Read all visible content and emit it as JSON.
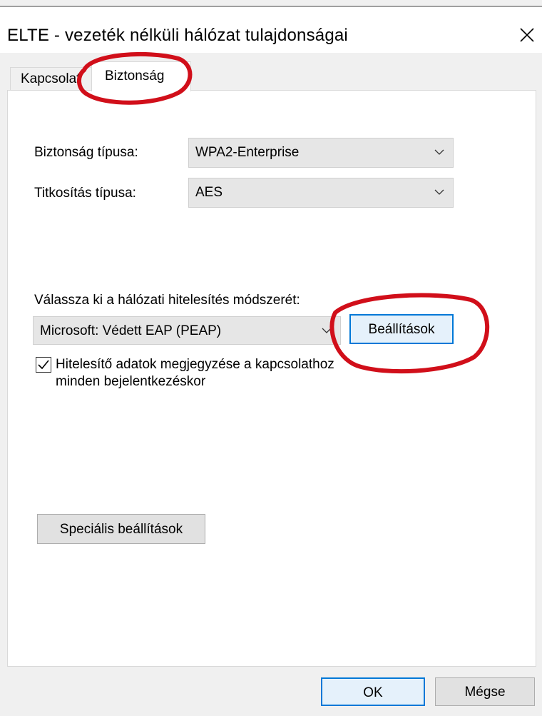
{
  "window": {
    "title": "ELTE - vezeték nélküli hálózat tulajdonságai"
  },
  "tabs": [
    {
      "label": "Kapcsolat"
    },
    {
      "label": "Biztonság"
    }
  ],
  "security": {
    "security_type_label": "Biztonság típusa:",
    "security_type_value": "WPA2-Enterprise",
    "encryption_type_label": "Titkosítás típusa:",
    "encryption_type_value": "AES"
  },
  "authentication": {
    "method_label": "Válassza ki a hálózati hitelesítés módszerét:",
    "method_value": "Microsoft: Védett EAP (PEAP)",
    "settings_button": "Beállítások",
    "remember_line1": "Hitelesítő adatok megjegyzése a kapcsolathoz",
    "remember_line2": "minden bejelentkezéskor",
    "remember_checked": true
  },
  "advanced_button": "Speciális beállítások",
  "footer": {
    "ok_button": "OK",
    "cancel_button": "Mégse"
  },
  "colors": {
    "annotation_red": "#d10f1a",
    "focus_blue": "#0078d7"
  }
}
